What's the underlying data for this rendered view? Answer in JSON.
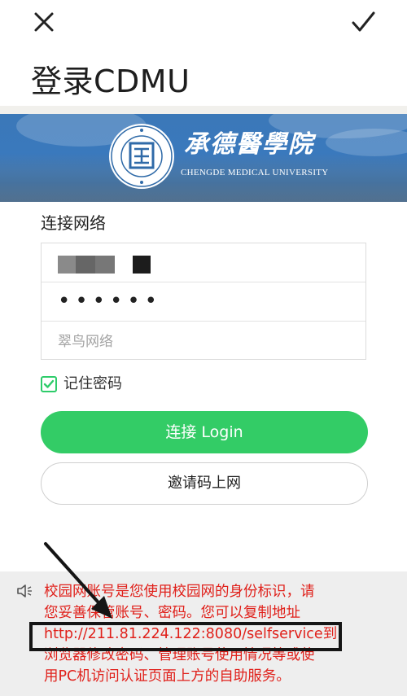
{
  "topbar": {
    "title": "登录CDMU"
  },
  "banner": {
    "school_cn": "承德醫學院",
    "school_en": "CHENGDE MEDICAL UNIVERSITY"
  },
  "form": {
    "heading": "连接网络",
    "password_mask": "••••••",
    "ssid_placeholder": "翠鸟网络",
    "remember_label": "记住密码",
    "remember_checked": true,
    "login_label": "连接 Login",
    "invite_label": "邀请码上网"
  },
  "notice": {
    "lines": [
      "校园网账号是您使用校园网的身份标识，请",
      "您妥善保管账号、密码。您可以复制地址",
      "http://211.81.224.122:8080/selfservice到",
      "浏览器修改密码、管理账号使用情况等或使",
      "用PC机访问认证页面上方的自助服务。"
    ]
  },
  "colors": {
    "accent_green": "#33cc66",
    "notice_red": "#e0201a",
    "banner_blue": "#3a79bd"
  },
  "icons": {
    "close": "close-icon",
    "confirm": "check-icon",
    "remember": "checkbox-checked-icon",
    "notice": "speaker-icon",
    "emblem": "university-emblem"
  }
}
